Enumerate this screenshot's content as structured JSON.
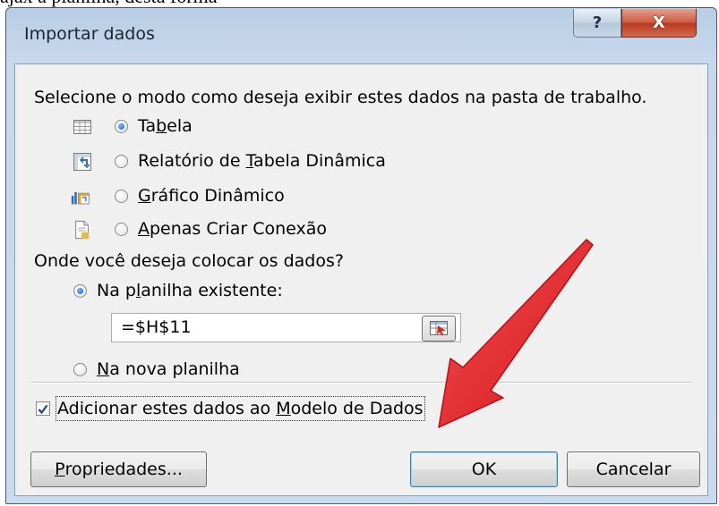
{
  "background": {
    "text": "ajax a planilha, desta forma"
  },
  "window": {
    "title": "Importar dados",
    "help_glyph": "?",
    "close_glyph": "X"
  },
  "display_mode": {
    "prompt": "Selecione o modo como deseja exibir estes dados na pasta de trabalho.",
    "options": [
      {
        "pre": "Ta",
        "key": "b",
        "post": "ela",
        "selected": true,
        "icon": "table-icon"
      },
      {
        "pre": "Relatório de ",
        "key": "T",
        "post": "abela Dinâmica",
        "selected": false,
        "icon": "pivot-table-icon"
      },
      {
        "pre": "",
        "key": "G",
        "post": "ráfico Dinâmico",
        "selected": false,
        "icon": "pivot-chart-icon"
      },
      {
        "pre": "",
        "key": "A",
        "post": "penas Criar Conexão",
        "selected": false,
        "icon": "connection-icon"
      }
    ]
  },
  "location": {
    "prompt": "Onde você deseja colocar os dados?",
    "existing": {
      "pre": "Na p",
      "key": "l",
      "post": "anilha existente:",
      "selected": true
    },
    "cell_reference": "=$H$11",
    "new_sheet": {
      "pre": "",
      "key": "N",
      "post": "a nova planilha",
      "selected": false
    }
  },
  "data_model": {
    "pre": "Adicionar estes dados ao ",
    "key": "M",
    "post": "odelo de Dados",
    "checked": true
  },
  "buttons": {
    "properties": {
      "pre": "",
      "key": "P",
      "post": "ropriedades..."
    },
    "ok": "OK",
    "cancel": "Cancelar"
  },
  "colors": {
    "arrow": "#e8202a",
    "dialog_bg": "#f0f0f0",
    "frame": "#c9dbef",
    "close": "#c9462a"
  }
}
